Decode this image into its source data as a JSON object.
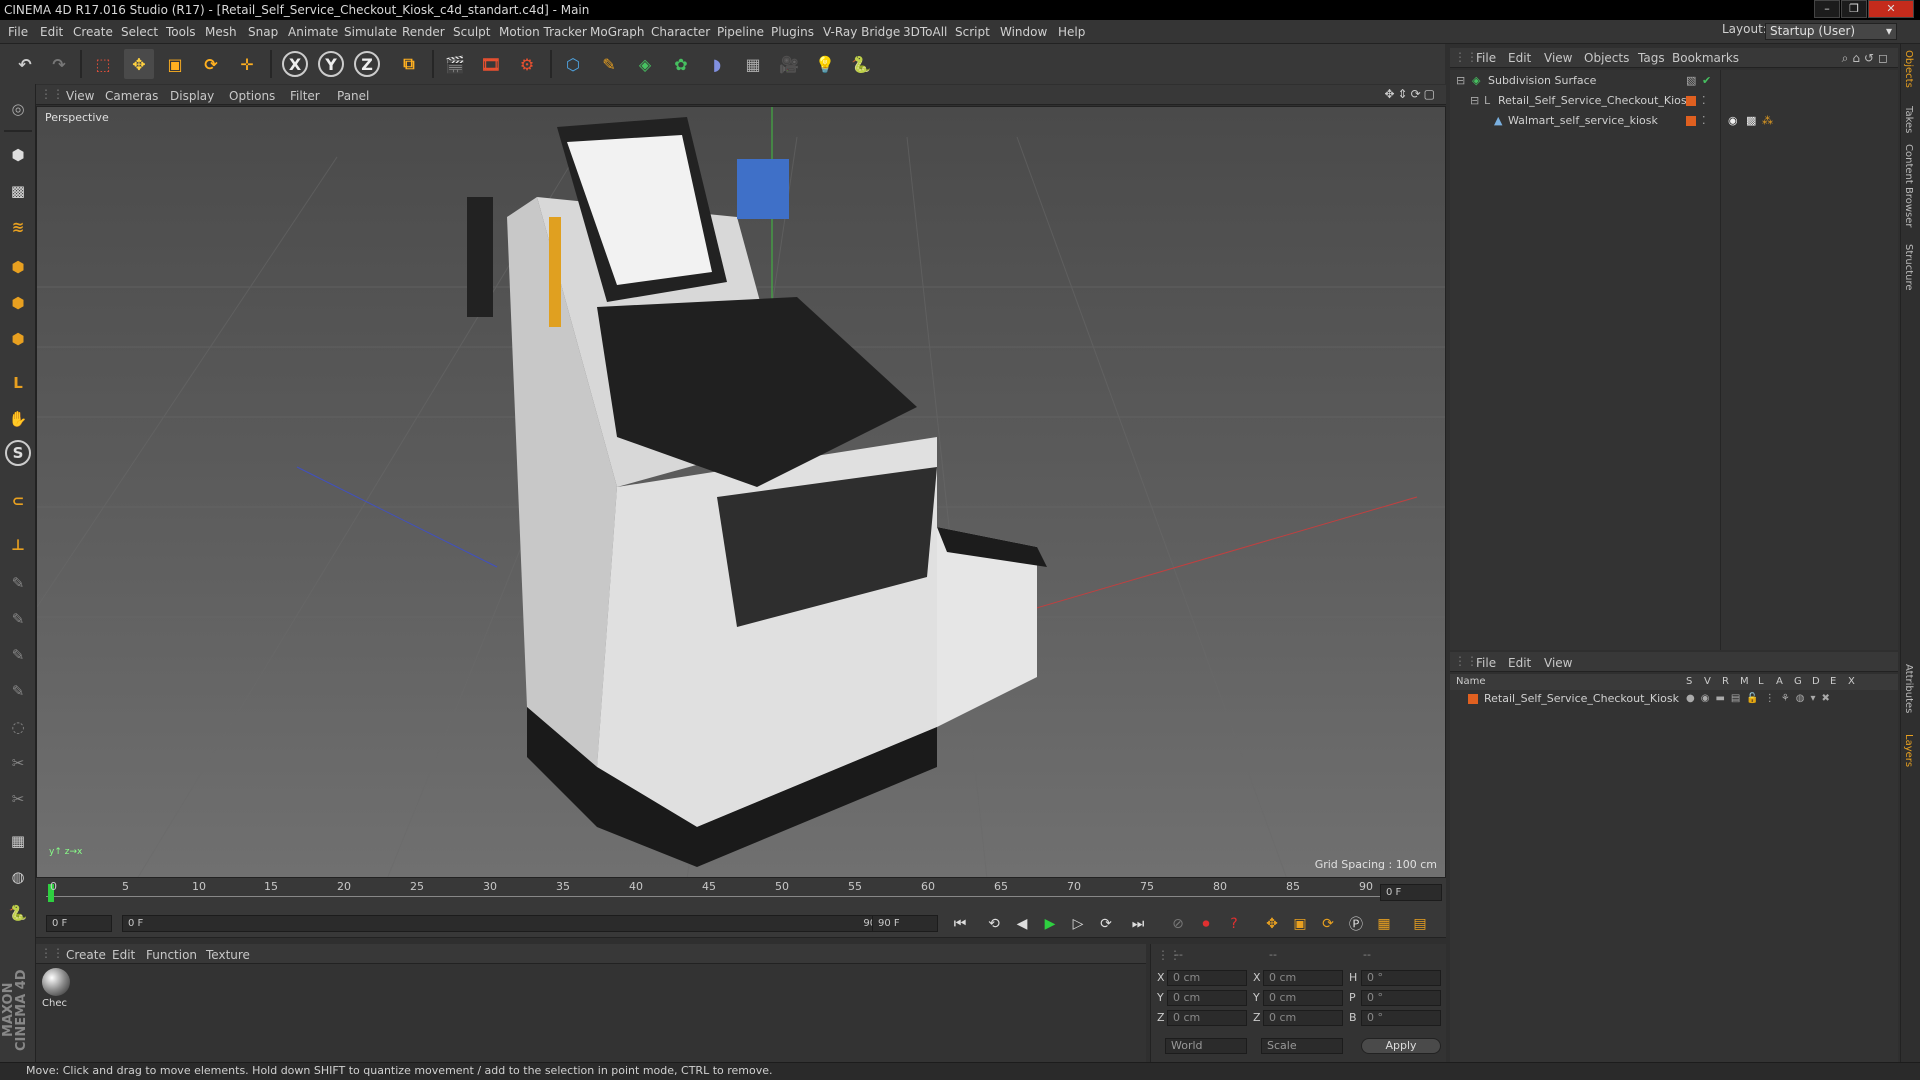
{
  "window": {
    "title": "CINEMA 4D R17.016 Studio (R17) - [Retail_Self_Service_Checkout_Kiosk_c4d_standart.c4d] - Main"
  },
  "menu": [
    "File",
    "Edit",
    "Create",
    "Select",
    "Tools",
    "Mesh",
    "Snap",
    "Animate",
    "Simulate",
    "Render",
    "Sculpt",
    "Motion Tracker",
    "MoGraph",
    "Character",
    "Pipeline",
    "Plugins",
    "V-Ray Bridge",
    "3DToAll",
    "Script",
    "Window",
    "Help"
  ],
  "layout": {
    "label": "Layout:",
    "value": "Startup (User)"
  },
  "viewport": {
    "menu": [
      "View",
      "Cameras",
      "Display",
      "Options",
      "Filter",
      "Panel"
    ],
    "camera_label": "Perspective",
    "grid_spacing": "Grid Spacing : 100 cm"
  },
  "timeline": {
    "ticks": [
      "0",
      "5",
      "10",
      "15",
      "20",
      "25",
      "30",
      "35",
      "40",
      "45",
      "50",
      "55",
      "60",
      "65",
      "70",
      "75",
      "80",
      "85",
      "90"
    ],
    "current_frame": "0 F",
    "start_field": "0 F",
    "range_start": "0 F",
    "range_end": "90 F",
    "end_field": "90 F"
  },
  "material": {
    "menu": [
      "Create",
      "Edit",
      "Function",
      "Texture"
    ],
    "items": [
      {
        "label": "Chec"
      }
    ]
  },
  "coordinates": {
    "header": [
      "--",
      "--",
      "--"
    ],
    "rows": [
      {
        "l1": "X",
        "v1": "0 cm",
        "l2": "X",
        "v2": "0 cm",
        "l3": "H",
        "v3": "0 °"
      },
      {
        "l1": "Y",
        "v1": "0 cm",
        "l2": "Y",
        "v2": "0 cm",
        "l3": "P",
        "v3": "0 °"
      },
      {
        "l1": "Z",
        "v1": "0 cm",
        "l2": "Z",
        "v2": "0 cm",
        "l3": "B",
        "v3": "0 °"
      }
    ],
    "mode": "World",
    "scale": "Scale",
    "apply": "Apply"
  },
  "objects": {
    "menu": [
      "File",
      "Edit",
      "View",
      "Objects",
      "Tags",
      "Bookmarks"
    ],
    "tree": [
      {
        "name": "Subdivision Surface"
      },
      {
        "name": "Retail_Self_Service_Checkout_Kiosk"
      },
      {
        "name": "Walmart_self_service_kiosk"
      }
    ]
  },
  "layers": {
    "menu": [
      "File",
      "Edit",
      "View"
    ],
    "header_name": "Name",
    "header_cols": [
      "S",
      "V",
      "R",
      "M",
      "L",
      "A",
      "G",
      "D",
      "E",
      "X"
    ],
    "items": [
      {
        "name": "Retail_Self_Service_Checkout_Kiosk"
      }
    ]
  },
  "side_tabs": [
    "Objects",
    "Takes",
    "Content Browser",
    "Structure",
    "Attributes",
    "Layers"
  ],
  "brand": "MAXON CINEMA 4D",
  "status": "Move: Click and drag to move elements. Hold down SHIFT to quantize movement / add to the selection in point mode, CTRL to remove.",
  "colors": {
    "accent_orange": "#e8a020",
    "accent_blue": "#4fa3e0",
    "layer_orange": "#e06020"
  }
}
